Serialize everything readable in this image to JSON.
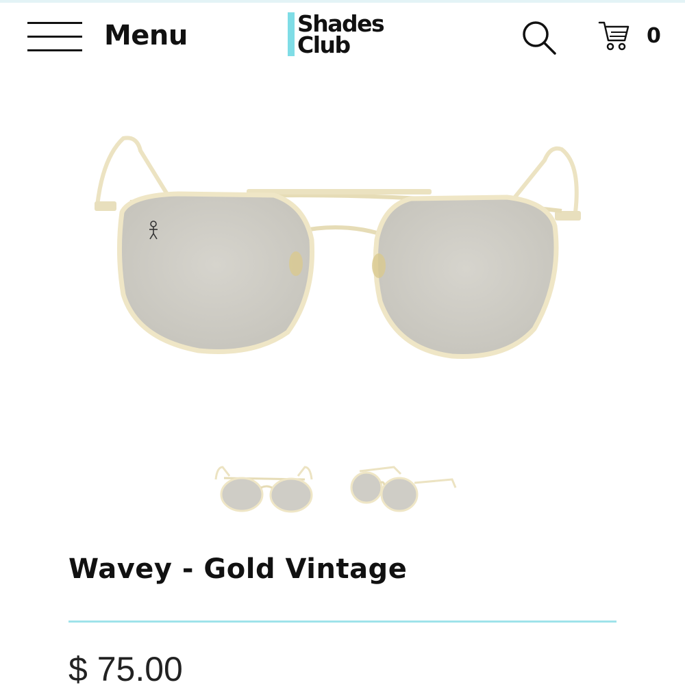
{
  "header": {
    "menu_label": "Menu",
    "logo_line1": "Shades",
    "logo_line2": "Club",
    "cart_count": "0",
    "icons": [
      "hamburger-icon",
      "search-icon",
      "cart-icon"
    ]
  },
  "product": {
    "title": "Wavey - Gold Vintage",
    "price": "$ 75.00",
    "thumbnails": [
      "front-view",
      "angled-view"
    ]
  },
  "colors": {
    "accent": "#7fdde6",
    "divider": "#9fe3ea",
    "frame_gold": "#e9dfb8",
    "lens_gray": "#cfcdc6"
  }
}
